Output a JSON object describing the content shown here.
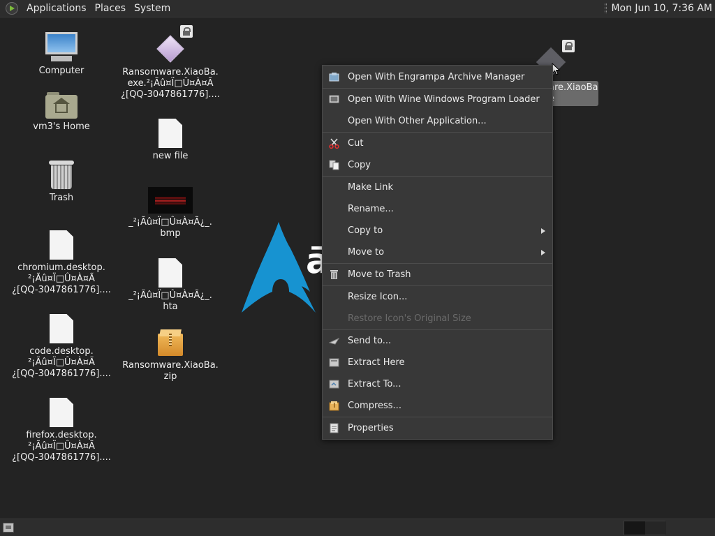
{
  "top_panel": {
    "menus": [
      "Applications",
      "Places",
      "System"
    ],
    "clock": "Mon Jun 10,  7:36 AM"
  },
  "desktop_left": [
    {
      "icon": "computer-icon",
      "lines": [
        "Computer"
      ]
    },
    {
      "icon": "home-folder-icon",
      "lines": [
        "vm3's Home"
      ]
    },
    {
      "icon": "trash-icon",
      "lines": [
        "Trash"
      ]
    },
    {
      "icon": "file-icon",
      "lines": [
        "chromium.desktop.",
        "²¡Ãû¤Ï□Û¤À¤Ã",
        "¿[QQ-3047861776]...."
      ]
    },
    {
      "icon": "file-icon",
      "lines": [
        "code.desktop.",
        "²¡Ãû¤Ï□Û¤À¤Ã",
        "¿[QQ-3047861776]...."
      ]
    },
    {
      "icon": "file-icon",
      "lines": [
        "firefox.desktop.",
        "²¡Ãû¤Ï□Û¤À¤Ã",
        "¿[QQ-3047861776]...."
      ]
    }
  ],
  "desktop_right": [
    {
      "icon": "encrypted-exe-icon",
      "lines": [
        "Ransomware.XiaoBa.",
        "exe.²¡Ãû¤Ï□Û¤À¤Ã",
        "¿[QQ-3047861776]...."
      ]
    },
    {
      "icon": "file-icon",
      "lines": [
        "new file"
      ]
    },
    {
      "icon": "bmp-thumbnail-icon",
      "lines": [
        "_²¡Ãû¤Ï□Û¤À¤Ã¿_.",
        "bmp"
      ]
    },
    {
      "icon": "file-icon",
      "lines": [
        "_²¡Ãû¤Ï□Û¤À¤Ã¿_.",
        "hta"
      ]
    },
    {
      "icon": "zip-archive-icon",
      "lines": [
        "Ransomware.XiaoBa.",
        "zip"
      ]
    }
  ],
  "wallpaper": {
    "logo_text": "ā"
  },
  "selected_icon": {
    "lines": [
      "are.XiaoBa.",
      "e"
    ]
  },
  "context_menu": {
    "groups": [
      [
        {
          "label": "Open With Engrampa Archive Manager",
          "icon": "archive-manager-icon"
        }
      ],
      [
        {
          "label": "Open With Wine Windows Program Loader",
          "icon": "wine-loader-icon"
        },
        {
          "label": "Open With Other Application...",
          "icon": ""
        }
      ],
      [
        {
          "label": "Cut",
          "icon": "scissors-icon"
        },
        {
          "label": "Copy",
          "icon": "copy-icon"
        }
      ],
      [
        {
          "label": "Make Link",
          "icon": ""
        },
        {
          "label": "Rename...",
          "icon": ""
        },
        {
          "label": "Copy to",
          "icon": "",
          "submenu": true
        },
        {
          "label": "Move to",
          "icon": "",
          "submenu": true
        }
      ],
      [
        {
          "label": "Move to Trash",
          "icon": "trash-icon"
        }
      ],
      [
        {
          "label": "Resize Icon...",
          "icon": ""
        },
        {
          "label": "Restore Icon's Original Size",
          "icon": "",
          "disabled": true
        }
      ],
      [
        {
          "label": "Send to...",
          "icon": "send-to-icon"
        },
        {
          "label": "Extract Here",
          "icon": "extract-here-icon"
        },
        {
          "label": "Extract To...",
          "icon": "extract-to-icon"
        },
        {
          "label": "Compress...",
          "icon": "compress-icon"
        }
      ],
      [
        {
          "label": "Properties",
          "icon": "properties-icon"
        }
      ]
    ]
  },
  "colors": {
    "desktop_bg": "#232323",
    "panel_bg": "#2d2d2d",
    "menu_bg": "#383838",
    "arch_blue": "#1793d1",
    "selection_gray": "#6b6b6b"
  }
}
